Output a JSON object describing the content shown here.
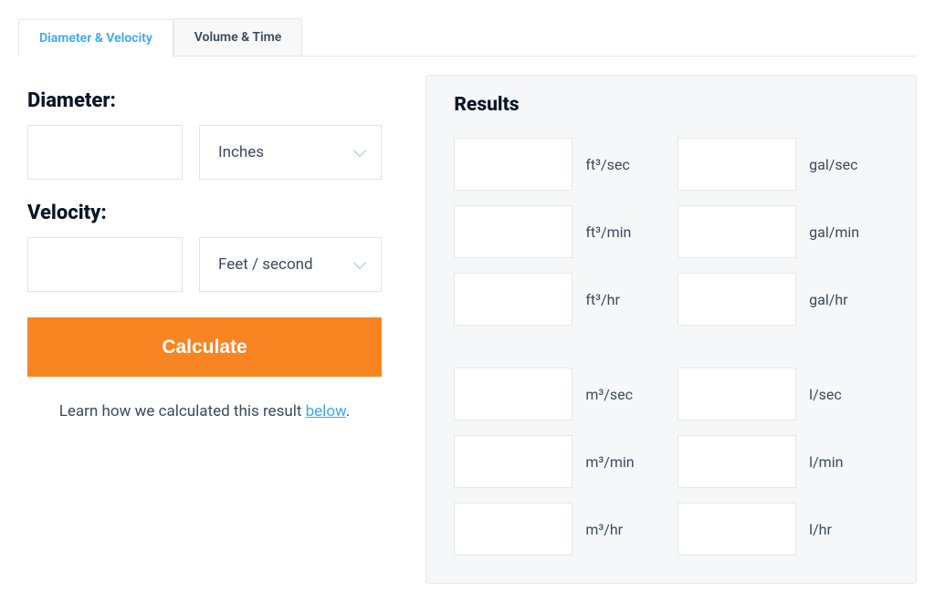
{
  "tabs": {
    "active": "Diameter & Velocity",
    "inactive": "Volume & Time"
  },
  "inputs": {
    "diameter_label": "Diameter:",
    "diameter_value": "",
    "diameter_unit": "Inches",
    "velocity_label": "Velocity:",
    "velocity_value": "",
    "velocity_unit": "Feet / second"
  },
  "button": {
    "calculate": "Calculate"
  },
  "learn": {
    "prefix": "Learn how we calculated this result ",
    "link": "below",
    "suffix": "."
  },
  "results": {
    "title": "Results",
    "items": [
      {
        "value": "",
        "label": "ft³/sec"
      },
      {
        "value": "",
        "label": "gal/sec"
      },
      {
        "value": "",
        "label": "ft³/min"
      },
      {
        "value": "",
        "label": "gal/min"
      },
      {
        "value": "",
        "label": "ft³/hr"
      },
      {
        "value": "",
        "label": "gal/hr"
      },
      {
        "value": "",
        "label": "m³/sec"
      },
      {
        "value": "",
        "label": "l/sec"
      },
      {
        "value": "",
        "label": "m³/min"
      },
      {
        "value": "",
        "label": "l/min"
      },
      {
        "value": "",
        "label": "m³/hr"
      },
      {
        "value": "",
        "label": "l/hr"
      }
    ]
  }
}
